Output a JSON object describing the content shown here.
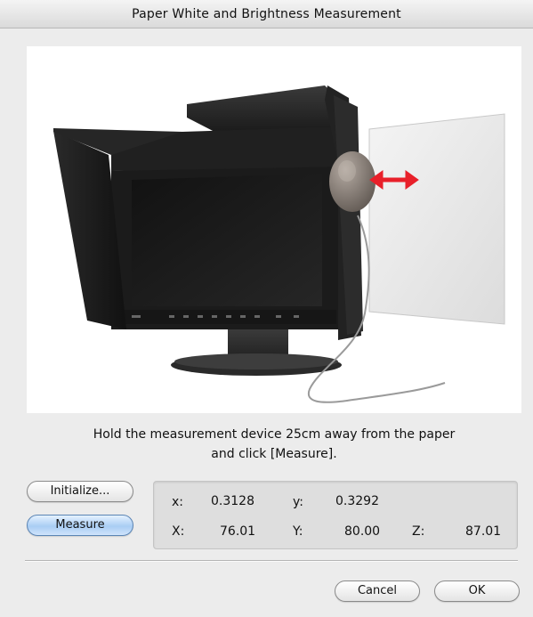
{
  "window": {
    "title": "Paper White and Brightness Measurement"
  },
  "instruction": {
    "line1": "Hold the measurement device 25cm away from the paper",
    "line2": "and click [Measure]."
  },
  "buttons": {
    "initialize": "Initialize...",
    "measure": "Measure",
    "cancel": "Cancel",
    "ok": "OK"
  },
  "readout": {
    "x_label": "x:",
    "x_value": "0.3128",
    "y_label": "y:",
    "y_value": "0.3292",
    "X_label": "X:",
    "X_value": "76.01",
    "Y_label": "Y:",
    "Y_value": "80.00",
    "Z_label": "Z:",
    "Z_value": "87.01"
  },
  "icons": {
    "illustration": "monitor-with-hood-and-sensor-illustration"
  },
  "colors": {
    "default_button": "#a9cdf4",
    "arrow": "#e8202a"
  }
}
